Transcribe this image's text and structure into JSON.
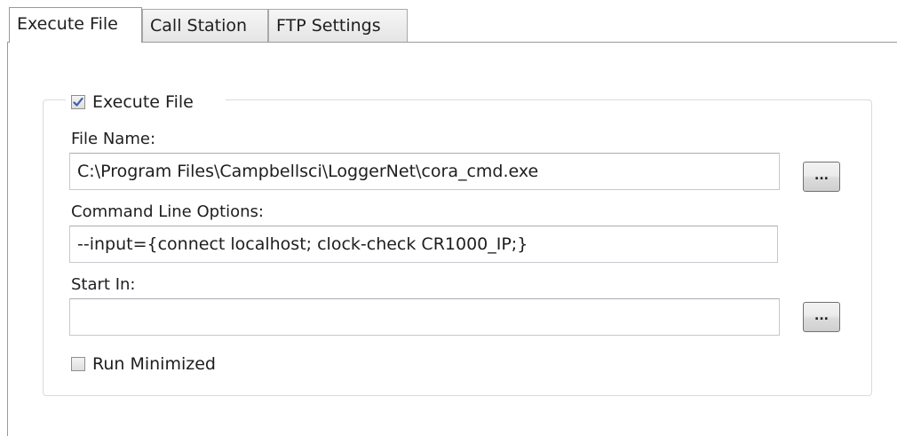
{
  "tabs": [
    {
      "label": "Execute File",
      "active": true
    },
    {
      "label": "Call Station",
      "active": false
    },
    {
      "label": "FTP Settings",
      "active": false
    }
  ],
  "execute_group": {
    "checkbox_label": "Execute File",
    "checked": true,
    "file_name": {
      "label": "File Name:",
      "value": "C:\\Program Files\\Campbellsci\\LoggerNet\\cora_cmd.exe",
      "browse_label": "..."
    },
    "command_line": {
      "label": "Command Line Options:",
      "value": "--input={connect localhost; clock-check CR1000_IP;}"
    },
    "start_in": {
      "label": "Start In:",
      "value": "",
      "browse_label": "..."
    },
    "run_minimized": {
      "label": "Run Minimized",
      "checked": false
    }
  },
  "colors": {
    "check_mark": "#3a5da8",
    "group_border": "#d6dbe1",
    "tab_border": "#9a9a9a"
  }
}
